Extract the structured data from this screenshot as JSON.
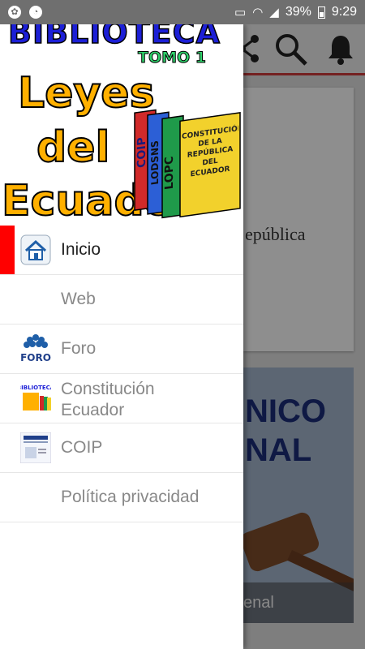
{
  "status_bar": {
    "battery": "39%",
    "time": "9:29"
  },
  "background_app": {
    "card1_text": "epública",
    "card2_title_line1": "NICO",
    "card2_title_line2": "NAL",
    "card2_caption": "enal"
  },
  "drawer": {
    "header": {
      "title": "BIBLIOTECA",
      "subtitle": "TOMO 1",
      "line1": "Leyes",
      "line2": "del",
      "line3": "Ecuador",
      "book_labels": [
        "COIP",
        "LODSNS",
        "LOPC",
        "CONSTITUCIÓN DE LA REPÚBLICA DEL ECUADOR"
      ]
    },
    "items": [
      {
        "label": "Inicio",
        "icon": "home-icon",
        "selected": true
      },
      {
        "label": "Web",
        "icon": "",
        "selected": false
      },
      {
        "label": "Foro",
        "icon": "foro-icon",
        "selected": false
      },
      {
        "label_line1": "Constitución",
        "label_line2": "Ecuador",
        "icon": "constitucion-icon",
        "selected": false
      },
      {
        "label": "COIP",
        "icon": "coip-icon",
        "selected": false
      },
      {
        "label": "Política privacidad",
        "icon": "",
        "selected": false
      }
    ]
  },
  "colors": {
    "selected_indicator": "#ff0000",
    "toolbar_underline": "#c93a3a"
  }
}
